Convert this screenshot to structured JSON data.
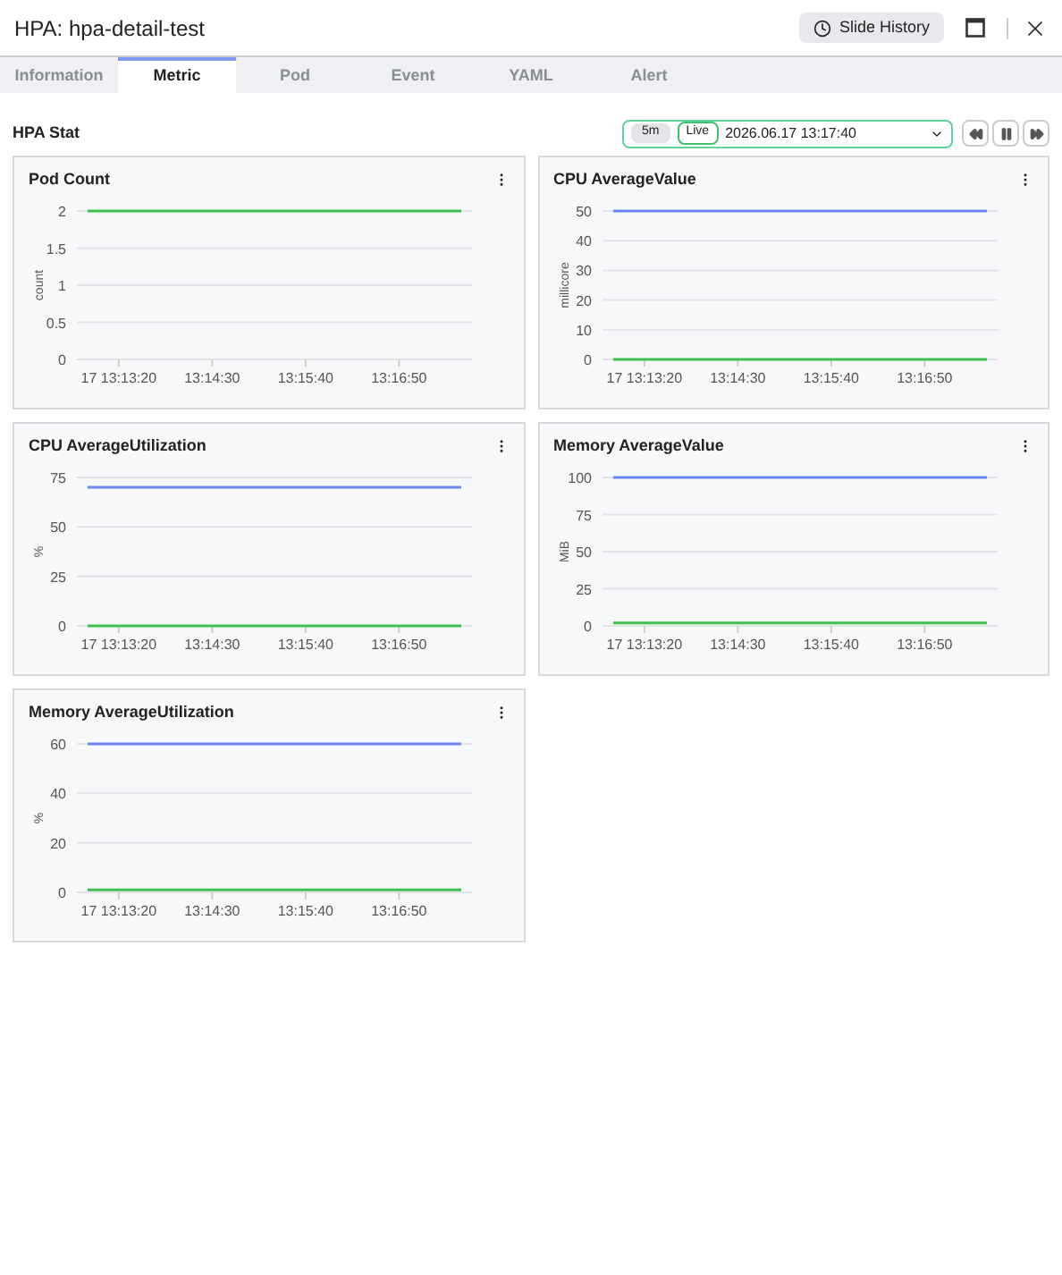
{
  "window": {
    "title": "HPA: hpa-detail-test",
    "history_button": "Slide History"
  },
  "tabs": [
    {
      "label": "Information",
      "selected": false
    },
    {
      "label": "Metric",
      "selected": true
    },
    {
      "label": "Pod",
      "selected": false
    },
    {
      "label": "Event",
      "selected": false
    },
    {
      "label": "YAML",
      "selected": false
    },
    {
      "label": "Alert",
      "selected": false
    }
  ],
  "section": {
    "title": "HPA Stat",
    "duration": "5m",
    "live_label": "Live",
    "live": true,
    "datetime": "2026.06.17 13:17:40"
  },
  "panels": [
    {
      "title": "Pod Count",
      "chart_data": {
        "type": "line",
        "grid": true,
        "ylabel": "count",
        "categories": [
          null,
          "17 13:13:20",
          null,
          null,
          "13:14:30",
          null,
          null,
          "13:15:40",
          null,
          null,
          "13:16:50",
          null,
          null
        ],
        "ylim": [
          0,
          2
        ],
        "yticks": [
          0,
          0.5,
          1,
          1.5,
          2
        ],
        "series": [
          {
            "color": "#3fbf4f",
            "values": [
              2,
              2,
              2,
              2,
              2,
              2,
              2,
              2,
              2,
              2,
              2,
              2,
              2
            ]
          }
        ]
      }
    },
    {
      "title": "CPU AverageValue",
      "chart_data": {
        "type": "line",
        "grid": true,
        "ylabel": "millicore",
        "categories": [
          null,
          "17 13:13:20",
          null,
          null,
          "13:14:30",
          null,
          null,
          "13:15:40",
          null,
          null,
          "13:16:50",
          null,
          null
        ],
        "ylim": [
          0,
          50
        ],
        "yticks": [
          0,
          10,
          20,
          30,
          40,
          50
        ],
        "series": [
          {
            "color": "#6c85f0",
            "values": [
              50,
              50,
              50,
              50,
              50,
              50,
              50,
              50,
              50,
              50,
              50,
              50,
              50
            ]
          },
          {
            "color": "#3fbf4f",
            "values": [
              0,
              0,
              0,
              0,
              0,
              0,
              0,
              0,
              0,
              0,
              0,
              0,
              0
            ]
          }
        ]
      }
    },
    {
      "title": "CPU AverageUtilization",
      "chart_data": {
        "type": "line",
        "grid": true,
        "ylabel": "%",
        "categories": [
          null,
          "17 13:13:20",
          null,
          null,
          "13:14:30",
          null,
          null,
          "13:15:40",
          null,
          null,
          "13:16:50",
          null,
          null
        ],
        "ylim": [
          0,
          75
        ],
        "yticks": [
          0,
          25,
          50,
          75
        ],
        "series": [
          {
            "color": "#6c85f0",
            "values": [
              70,
              70,
              70,
              70,
              70,
              70,
              70,
              70,
              70,
              70,
              70,
              70,
              70
            ]
          },
          {
            "color": "#3fbf4f",
            "values": [
              0,
              0,
              0,
              0,
              0,
              0,
              0,
              0,
              0,
              0,
              0,
              0,
              0
            ]
          }
        ]
      }
    },
    {
      "title": "Memory AverageValue",
      "chart_data": {
        "type": "line",
        "grid": true,
        "ylabel": "MiB",
        "categories": [
          null,
          "17 13:13:20",
          null,
          null,
          "13:14:30",
          null,
          null,
          "13:15:40",
          null,
          null,
          "13:16:50",
          null,
          null
        ],
        "ylim": [
          0,
          100
        ],
        "yticks": [
          0,
          25,
          50,
          75,
          100
        ],
        "series": [
          {
            "color": "#6c85f0",
            "values": [
              100,
              100,
              100,
              100,
              100,
              100,
              100,
              100,
              100,
              100,
              100,
              100,
              100
            ]
          },
          {
            "color": "#3fbf4f",
            "values": [
              2,
              2,
              2,
              2,
              2,
              2,
              2,
              2,
              2,
              2,
              2,
              2,
              2
            ]
          }
        ]
      }
    },
    {
      "title": "Memory AverageUtilization",
      "chart_data": {
        "type": "line",
        "grid": true,
        "ylabel": "%",
        "categories": [
          null,
          "17 13:13:20",
          null,
          null,
          "13:14:30",
          null,
          null,
          "13:15:40",
          null,
          null,
          "13:16:50",
          null,
          null
        ],
        "ylim": [
          0,
          60
        ],
        "yticks": [
          0,
          20,
          40,
          60
        ],
        "series": [
          {
            "color": "#6c85f0",
            "values": [
              60,
              60,
              60,
              60,
              60,
              60,
              60,
              60,
              60,
              60,
              60,
              60,
              60
            ]
          },
          {
            "color": "#3fbf4f",
            "values": [
              1,
              1,
              1,
              1,
              1,
              1,
              1,
              1,
              1,
              1,
              1,
              1,
              1
            ]
          }
        ]
      }
    }
  ]
}
